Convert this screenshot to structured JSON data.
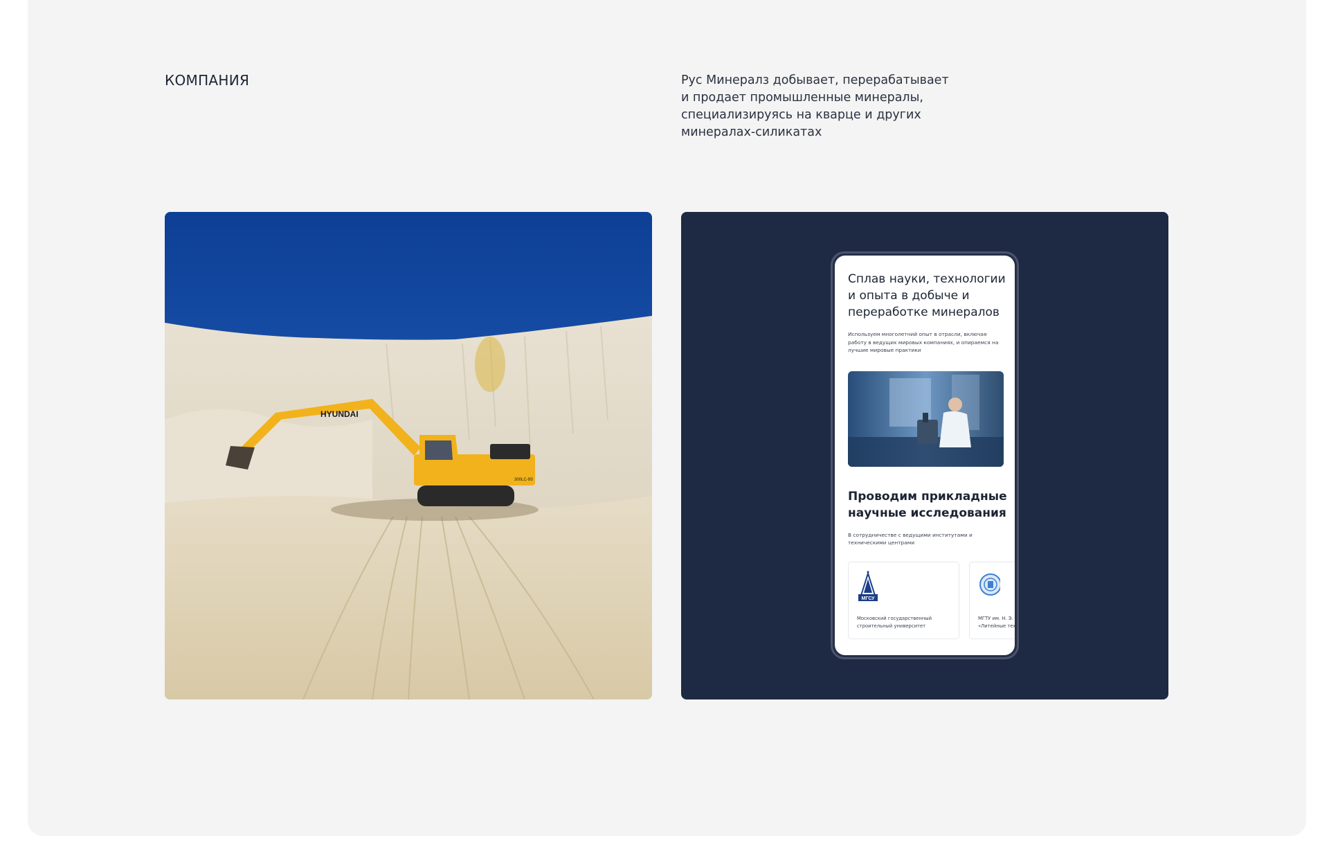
{
  "section": {
    "label": "КОМПАНИЯ"
  },
  "intro": {
    "text": "Рус Минералз добывает, перерабатывает и продает промышленные минералы, специализируясь на кварце и других минералах-силикатах"
  },
  "photo": {
    "excavator_brand": "HYUNDAI",
    "model": "300LC-9S"
  },
  "mobile": {
    "heading1": "Сплав науки, технологии и опыта в добыче и переработке минералов",
    "text1": "Используем многолетний опыт в отрасли, включая работу в ведущих мировых компаниях, и опираемся на лучшие мировые практики",
    "heading2": "Проводим прикладные научные исследования",
    "text2": "В сотрудничестве с ведущими институтами и техническими центрами",
    "partners": [
      {
        "logo_text": "МГСУ",
        "caption_line1": "Московский государственный",
        "caption_line2": "строительный университет"
      },
      {
        "caption_line1": "МГТУ им. Н. Э. Баумана",
        "caption_line2": "«Литейные технологии»"
      }
    ]
  },
  "colors": {
    "panel_bg": "#f4f4f4",
    "dark_card": "#1e2943",
    "text": "#1c2434",
    "excavator": "#f2b21c"
  }
}
